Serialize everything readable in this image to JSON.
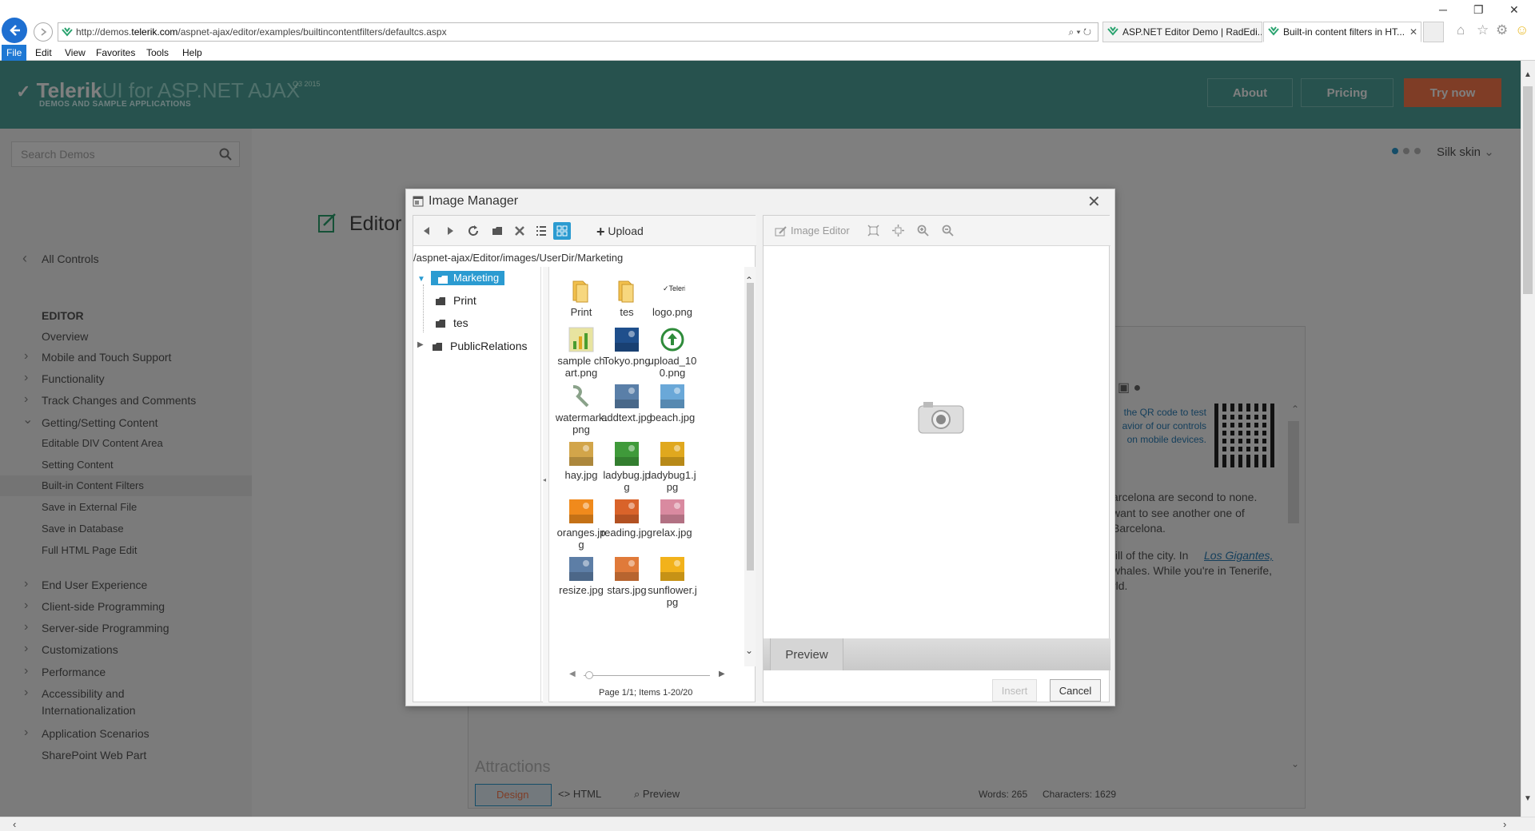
{
  "browser": {
    "url_prefix": "http://demos.",
    "url_domain": "telerik.com",
    "url_path": "/aspnet-ajax/editor/examples/builtincontentfilters/defaultcs.aspx",
    "tabs": [
      {
        "label": "ASP.NET Editor Demo | RadEdi..."
      },
      {
        "label": "Built-in content filters in HT..."
      }
    ],
    "menu": [
      "File",
      "Edit",
      "View",
      "Favorites",
      "Tools",
      "Help"
    ]
  },
  "header": {
    "brand": "Telerik",
    "product": "UI for ASP.NET AJAX",
    "version": "Q3 2015",
    "subtitle": "DEMOS AND SAMPLE APPLICATIONS",
    "buttons": {
      "about": "About",
      "pricing": "Pricing",
      "try": "Try now"
    }
  },
  "sidebar": {
    "search_placeholder": "Search Demos",
    "all_controls": "All Controls",
    "section": "EDITOR",
    "items": [
      {
        "label": "Overview"
      },
      {
        "label": "Mobile and Touch Support"
      },
      {
        "label": "Functionality"
      },
      {
        "label": "Track Changes and Comments"
      },
      {
        "label": "Getting/Setting Content"
      },
      {
        "label": "Editable DIV Content Area"
      },
      {
        "label": "Setting Content"
      },
      {
        "label": "Built-in Content Filters"
      },
      {
        "label": "Save in External File"
      },
      {
        "label": "Save in Database"
      },
      {
        "label": "Full HTML Page Edit"
      },
      {
        "label": "End User Experience"
      },
      {
        "label": "Client-side Programming"
      },
      {
        "label": "Server-side Programming"
      },
      {
        "label": "Customizations"
      },
      {
        "label": "Performance"
      },
      {
        "label": "Accessibility and"
      },
      {
        "label": "Internationalization"
      },
      {
        "label": "Application Scenarios"
      },
      {
        "label": "SharePoint Web Part"
      }
    ]
  },
  "main": {
    "skin": "Silk skin",
    "title": "Editor",
    "qr_text": [
      "the QR code to test",
      "avior of our controls",
      "on mobile devices."
    ],
    "body_text": [
      "arcelona are second to none.",
      "want to see another one of",
      "Barcelona.",
      "fill of the city. In",
      "Los Gigantes,",
      "whales. While you're in Tenerife,",
      "rld."
    ],
    "attractions": "Attractions",
    "modes": {
      "design": "Design",
      "html": "HTML",
      "preview": "Preview"
    },
    "stats": {
      "words": "Words: 265",
      "chars": "Characters: 1629"
    }
  },
  "dialog": {
    "title": "Image Manager",
    "upload": "Upload",
    "path": "/aspnet-ajax/Editor/images/UserDir/Marketing",
    "tree": {
      "root": "Marketing",
      "children": [
        "Print",
        "tes"
      ],
      "sibling": "PublicRelations"
    },
    "files": [
      {
        "name": "Print",
        "icon": "folder",
        "color": "#f2c14e"
      },
      {
        "name": "tes",
        "icon": "folder",
        "color": "#f2c14e"
      },
      {
        "name": "logo.png",
        "icon": "logo",
        "color": "#ffffff"
      },
      {
        "name": "sample chart.png",
        "icon": "chart",
        "color": "#e8e4a0"
      },
      {
        "name": "Tokyo.png",
        "icon": "photo",
        "color": "#1f4f8c"
      },
      {
        "name": "upload_100.png",
        "icon": "upload",
        "color": "#2e8b3a"
      },
      {
        "name": "watermark.png",
        "icon": "watermark",
        "color": "#8aa28a"
      },
      {
        "name": "addtext.jpg",
        "icon": "photo",
        "color": "#5a7fa8"
      },
      {
        "name": "beach.jpg",
        "icon": "photo",
        "color": "#6aa8d8"
      },
      {
        "name": "hay.jpg",
        "icon": "photo",
        "color": "#d2a54a"
      },
      {
        "name": "ladybug.jpg",
        "icon": "photo",
        "color": "#3f9a3a"
      },
      {
        "name": "ladybug1.jpg",
        "icon": "photo",
        "color": "#e0a81e"
      },
      {
        "name": "oranges.jpg",
        "icon": "photo",
        "color": "#f08a1c"
      },
      {
        "name": "reading.jpg",
        "icon": "photo",
        "color": "#d9632a"
      },
      {
        "name": "relax.jpg",
        "icon": "photo",
        "color": "#d98aa0"
      },
      {
        "name": "resize.jpg",
        "icon": "photo",
        "color": "#5d7ea6"
      },
      {
        "name": "stars.jpg",
        "icon": "photo",
        "color": "#e07a3a"
      },
      {
        "name": "sunflower.jpg",
        "icon": "photo",
        "color": "#f2b21b"
      }
    ],
    "pager": "Page 1/1; Items 1-20/20",
    "image_editor": "Image Editor",
    "preview": "Preview",
    "insert": "Insert",
    "cancel": "Cancel"
  }
}
